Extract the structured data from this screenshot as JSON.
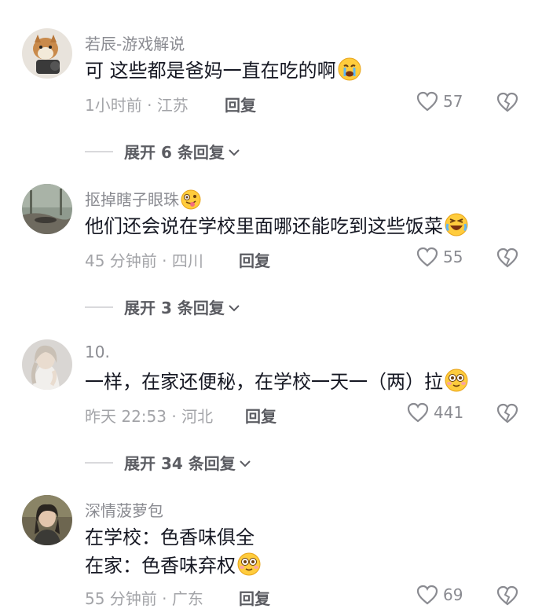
{
  "comments": [
    {
      "username": "若辰-游戏解说",
      "text": "可 这些都是爸妈一直在吃的啊",
      "emoji": "crying-face",
      "time_location": "1小时前 · 江苏",
      "reply_label": "回复",
      "likes": "57",
      "expand_label": "展开 6 条回复"
    },
    {
      "username": "抠掉瞎子眼珠",
      "username_emoji": "zany-face",
      "text": "他们还会说在学校里面哪还能吃到这些饭菜",
      "emoji": "laughing-face",
      "time_location": "45 分钟前 · 四川",
      "reply_label": "回复",
      "likes": "55",
      "expand_label": "展开 3 条回复"
    },
    {
      "username": "10.",
      "text": "一样，在家还便秘，在学校一天一（两）拉",
      "emoji": "flushed-face",
      "time_location": "昨天 22:53 · 河北",
      "reply_label": "回复",
      "likes": "441",
      "expand_label": "展开 34 条回复"
    },
    {
      "username": "深情菠萝包",
      "text_lines": [
        "在学校：色香味俱全",
        "在家：色香味弃权"
      ],
      "emoji": "flushed-face",
      "time_location": "55 分钟前 · 广东",
      "reply_label": "回复",
      "likes": "69"
    }
  ]
}
